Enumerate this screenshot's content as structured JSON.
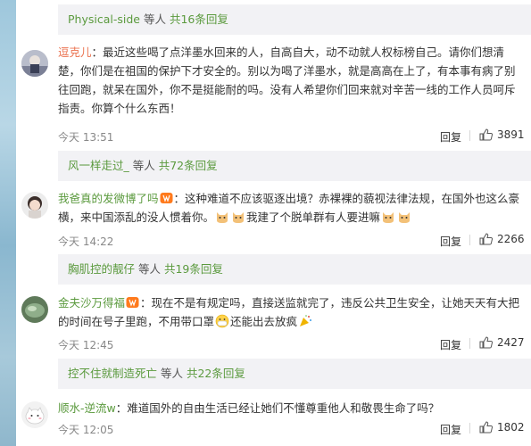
{
  "threads": [
    {
      "user": "Physical-side",
      "mid": " 等人 ",
      "count": "共16条回复",
      "comment": {
        "username": "逗克儿",
        "text": "：最近这些喝了点洋墨水回来的人，自高自大，动不动就人权标榜自己。请你们想清楚，你们是在祖国的保护下才安全的。别以为喝了洋墨水，就是高高在上了，有本事有病了别往回跑，就呆在国外，你不是挺能耐的吗。没有人希望你们回来就对辛苦一线的工作人员呵斥指责。你算个什么东西！",
        "time": "今天 13:51",
        "reply": "回复",
        "likes": "3891"
      }
    },
    {
      "user": "风一样走过_",
      "mid": " 等人 ",
      "count": "共72条回复",
      "comment": {
        "username": "我爸真的发微博了吗",
        "text1": "：这种难道不应该驱逐出境？赤裸裸的藐视法律法规，在国外也这么豪横，来中国添乱的没人惯着你。",
        "text2": "我建了个脱单群有人要进嘛",
        "time": "今天 14:22",
        "reply": "回复",
        "likes": "2266"
      }
    },
    {
      "user": "胸肌控的靓仔",
      "mid": " 等人 ",
      "count": "共19条回复",
      "comment": {
        "username": "金夫沙万得福",
        "text1": "：现在不是有规定吗，直接送监就完了，违反公共卫生安全，让她天天有大把的时间在号子里跑，不用带口罩",
        "text2": "还能出去放疯",
        "time": "今天 12:45",
        "reply": "回复",
        "likes": "2427"
      }
    },
    {
      "user": "控不住就制造死亡",
      "mid": " 等人 ",
      "count": "共22条回复",
      "comment": {
        "username": "顺水-逆流w",
        "text": "：难道国外的自由生活已经让她们不懂尊重他人和敬畏生命了吗？",
        "time": "今天 12:05",
        "reply": "回复",
        "likes": "1802"
      }
    }
  ],
  "icons": {
    "badge": "vip-badge-icon",
    "like": "thumbs-up-icon",
    "emoji_cat": "cat-face-icon",
    "emoji_mask": "mask-face-icon",
    "emoji_trumpet": "party-trumpet-icon"
  },
  "colors": {
    "link_green": "#5b9a3e",
    "username_orange": "#eb7350",
    "sub_bar_bg": "#f2f2f5",
    "meta_gray": "#888888"
  }
}
